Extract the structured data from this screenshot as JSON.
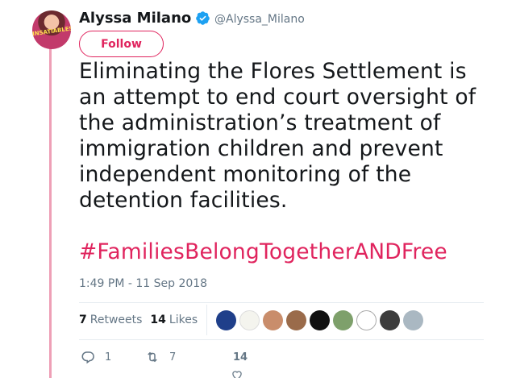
{
  "author": {
    "name": "Alyssa Milano",
    "handle": "@Alyssa_Milano",
    "avatar_text": "INSATIABLES"
  },
  "follow_label": "Follow",
  "tweet": {
    "text": "Eliminating the Flores Settlement is an attempt to end court oversight of the administration’s treatment of immigration children and prevent independent monitoring of the detention facilities.",
    "hashtag": "#FamiliesBelongTogetherANDFree",
    "timestamp": "1:49 PM - 11 Sep 2018"
  },
  "stats": {
    "retweets_count": "7",
    "retweets_label": "Retweets",
    "likes_count": "14",
    "likes_label": "Likes"
  },
  "actions": {
    "reply_count": "1",
    "retweet_count": "7",
    "like_count": "14"
  },
  "colors": {
    "accent": "#e0245e",
    "verified": "#1da1f2",
    "thread": "#ee9fb6",
    "muted": "#657786"
  },
  "icons": [
    "verified-badge-icon",
    "reply-icon",
    "retweet-icon",
    "heart-icon"
  ]
}
